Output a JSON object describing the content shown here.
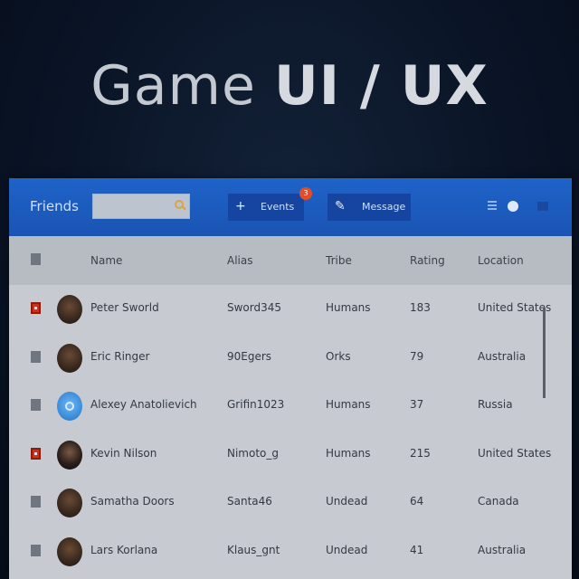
{
  "hero": {
    "light": "Game ",
    "bold": "UI / UX"
  },
  "topbar": {
    "friends_label": "Friends",
    "search_placeholder": "",
    "events_label": "Events",
    "events_badge": "3",
    "message_label": "Message"
  },
  "columns": [
    "Name",
    "Alias",
    "Tribe",
    "Rating",
    "Location"
  ],
  "rows": [
    {
      "checked": true,
      "name": "Peter Sworld",
      "alias": "Sword345",
      "tribe": "Humans",
      "rating": "183",
      "location": "United States",
      "avatar": "photo"
    },
    {
      "checked": false,
      "name": "Eric Ringer",
      "alias": "90Egers",
      "tribe": "Orks",
      "rating": "79",
      "location": "Australia",
      "avatar": "photo"
    },
    {
      "checked": false,
      "name": "Alexey Anatolievich",
      "alias": "Grifin1023",
      "tribe": "Humans",
      "rating": "37",
      "location": "Russia",
      "avatar": "blue"
    },
    {
      "checked": true,
      "name": "Kevin Nilson",
      "alias": "Nimoto_g",
      "tribe": "Humans",
      "rating": "215",
      "location": "United States",
      "avatar": "dark"
    },
    {
      "checked": false,
      "name": "Samatha Doors",
      "alias": "Santa46",
      "tribe": "Undead",
      "rating": "64",
      "location": "Canada",
      "avatar": "photo"
    },
    {
      "checked": false,
      "name": "Lars Korlana",
      "alias": "Klaus_gnt",
      "tribe": "Undead",
      "rating": "41",
      "location": "Australia",
      "avatar": "photo"
    }
  ],
  "colors": {
    "topbar": "#1f63c9",
    "button": "#1545a0",
    "badge": "#e34d2a",
    "checked": "#c8321e"
  }
}
